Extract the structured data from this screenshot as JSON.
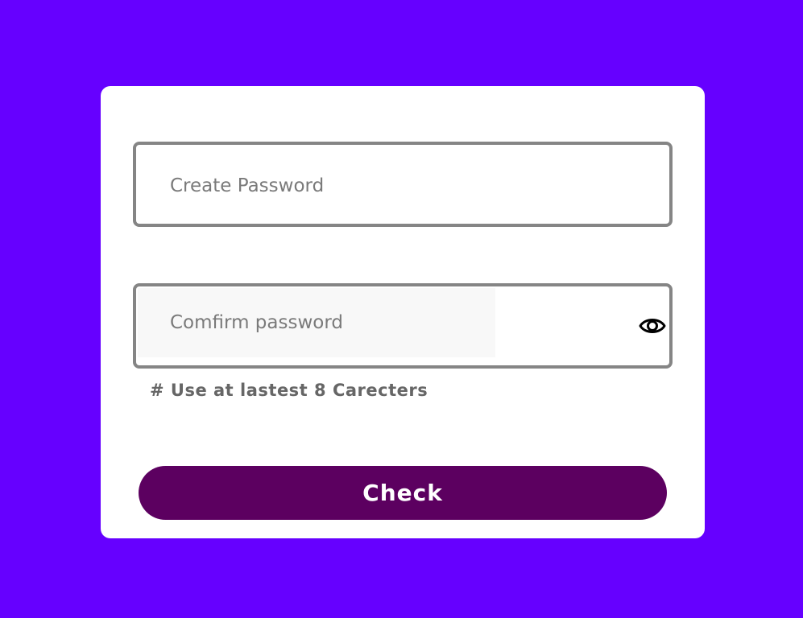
{
  "colors": {
    "background": "#6600ff",
    "card": "#ffffff",
    "field_border": "#858585",
    "button": "#5c0060",
    "button_text": "#ffffff",
    "hint_text": "#666666"
  },
  "form": {
    "create_password": {
      "value": "",
      "placeholder": "Create Password"
    },
    "confirm_password": {
      "value": "",
      "placeholder": "Comfirm password",
      "toggle_icon": "eye-icon"
    },
    "hint": "# Use at lastest 8 Carecters",
    "submit_label": "Check"
  }
}
